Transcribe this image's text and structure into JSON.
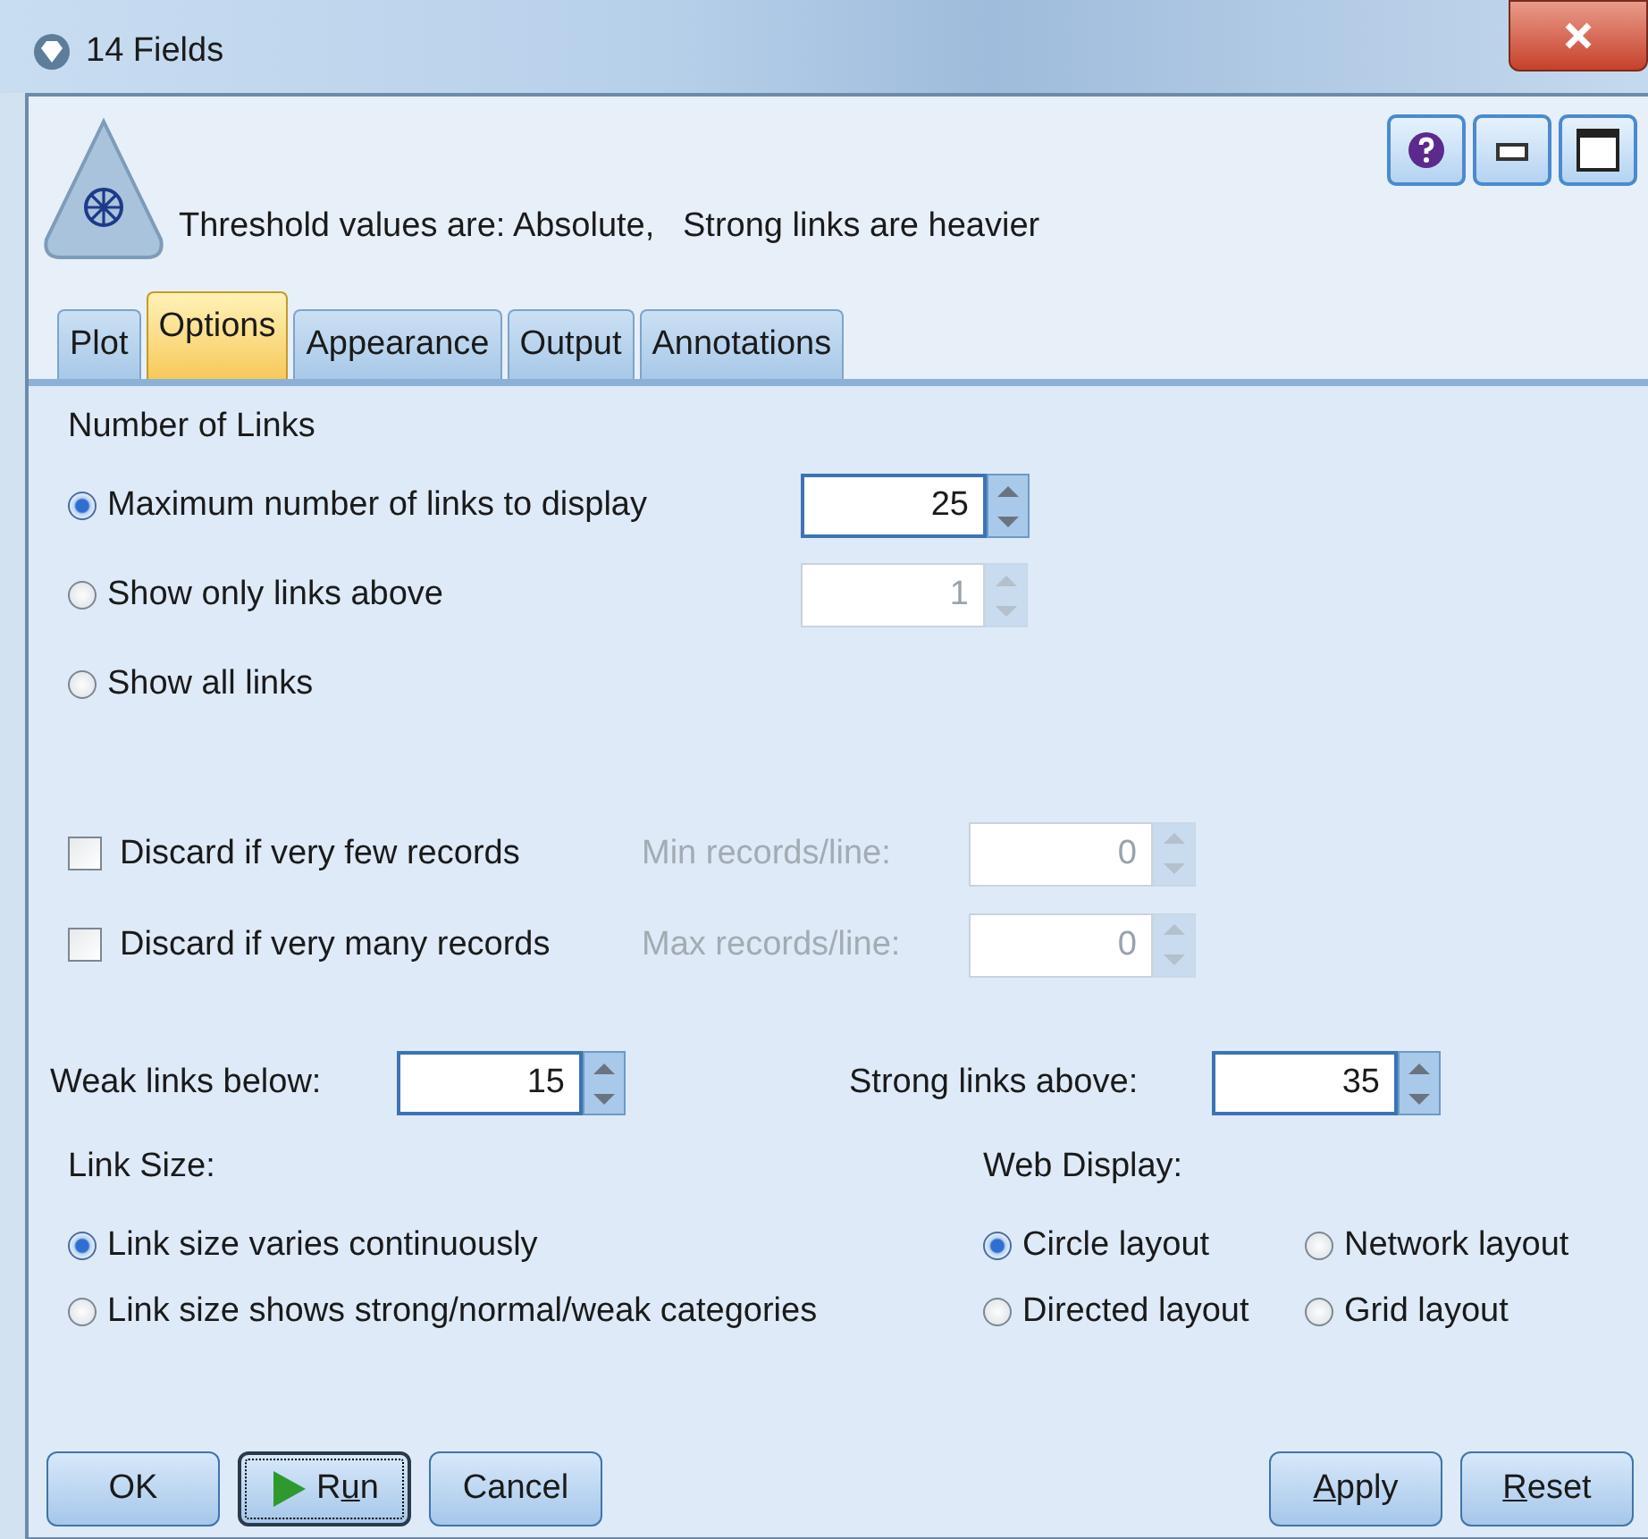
{
  "window": {
    "title": "14 Fields"
  },
  "header": {
    "description": "Threshold values are: Absolute,   Strong links are heavier"
  },
  "tabs": [
    {
      "label": "Plot",
      "selected": false
    },
    {
      "label": "Options",
      "selected": true
    },
    {
      "label": "Appearance",
      "selected": false
    },
    {
      "label": "Output",
      "selected": false
    },
    {
      "label": "Annotations",
      "selected": false
    }
  ],
  "number_of_links": {
    "heading": "Number of Links",
    "options": [
      {
        "label": "Maximum number of links to display",
        "selected": true,
        "spinner": {
          "value": "25",
          "disabled": false
        }
      },
      {
        "label": "Show only links above",
        "selected": false,
        "spinner": {
          "value": "1",
          "disabled": true
        }
      },
      {
        "label": "Show all links",
        "selected": false
      }
    ]
  },
  "discard": [
    {
      "label": "Discard if very few records",
      "checked": false,
      "field_label": "Min records/line:",
      "value": "0",
      "disabled": true
    },
    {
      "label": "Discard if very many records",
      "checked": false,
      "field_label": "Max records/line:",
      "value": "0",
      "disabled": true
    }
  ],
  "thresholds": [
    {
      "label": "Weak links below:",
      "value": "15"
    },
    {
      "label": "Strong links above:",
      "value": "35"
    }
  ],
  "link_size": {
    "heading": "Link Size:",
    "options": [
      {
        "label": "Link size varies continuously",
        "selected": true
      },
      {
        "label": "Link size shows strong/normal/weak categories",
        "selected": false
      }
    ]
  },
  "web_display": {
    "heading": "Web Display:",
    "options": [
      {
        "label": "Circle layout",
        "selected": true
      },
      {
        "label": "Network layout",
        "selected": false
      },
      {
        "label": "Directed layout",
        "selected": false
      },
      {
        "label": "Grid layout",
        "selected": false
      }
    ]
  },
  "buttons": [
    {
      "label": "OK",
      "focused": false
    },
    {
      "label": "Run",
      "focused": true
    },
    {
      "label": "Cancel",
      "focused": false
    },
    {
      "label": "Apply",
      "focused": false
    },
    {
      "label": "Reset",
      "focused": false
    }
  ]
}
